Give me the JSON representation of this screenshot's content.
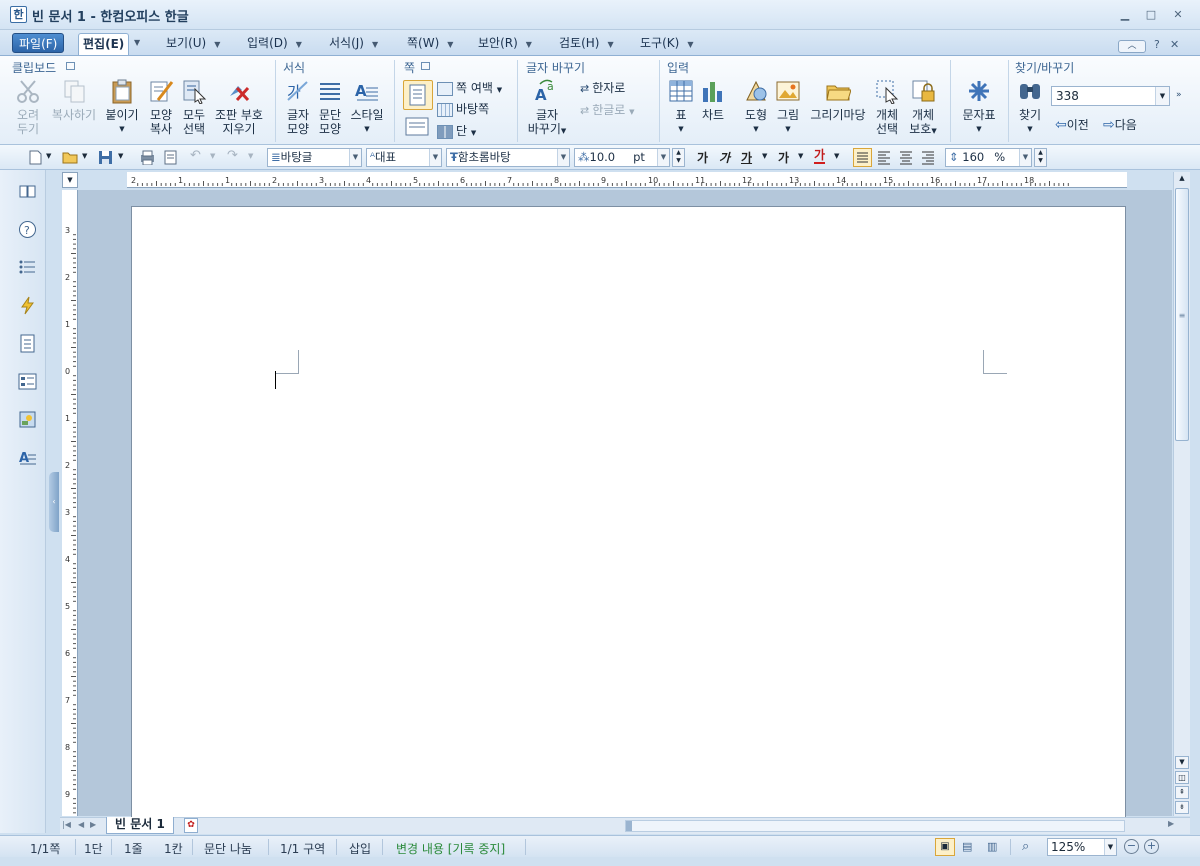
{
  "window": {
    "title": "빈 문서 1 - 한컴오피스 한글",
    "app_icon": "한"
  },
  "menus": [
    {
      "label": "파일(F)"
    },
    {
      "label": "편집(E)"
    },
    {
      "label": "보기(U)"
    },
    {
      "label": "입력(D)"
    },
    {
      "label": "서식(J)"
    },
    {
      "label": "쪽(W)"
    },
    {
      "label": "보안(R)"
    },
    {
      "label": "검토(H)"
    },
    {
      "label": "도구(K)"
    }
  ],
  "ribbon": {
    "groups": {
      "clipboard": "클립보드",
      "format": "서식",
      "page": "쪽",
      "convert": "글자 바꾸기",
      "insert": "입력",
      "find": "찾기/바꾸기"
    },
    "buttons": {
      "cut": "오려\n두기",
      "copy": "복사하기",
      "paste": "붙이기",
      "shape_copy": "모양\n복사",
      "select_all": "모두\n선택",
      "clear_marks": "조판 부호\n지우기",
      "char_shape": "글자\n모양",
      "para_shape": "문단\n모양",
      "style": "스타일",
      "page_margin": "쪽 여백",
      "background_page": "바탕쪽",
      "column": "단",
      "char_convert": "글자\n바꾸기",
      "to_hanja": "한자로",
      "to_hangul": "한글로",
      "table": "표",
      "chart": "차트",
      "shape": "도형",
      "picture": "그림",
      "drawing_gallery": "그리기마당",
      "select_object": "개체\n선택",
      "protect_object": "개체\n보호",
      "char_map": "문자표",
      "find": "찾기",
      "find_value": "338",
      "prev": "이전",
      "next": "다음"
    }
  },
  "toolbar": {
    "style": "바탕글",
    "lang": "대표",
    "font": "함초롬바탕",
    "size": "10.0",
    "size_unit": "pt",
    "bold": "가",
    "italic": "가",
    "underline": "가",
    "strike": "가",
    "color": "가",
    "line_spacing": "160",
    "line_spacing_unit": "%"
  },
  "ruler": {
    "h_ticks": [
      "2",
      "1",
      "1",
      "2",
      "3",
      "4",
      "5",
      "6",
      "7",
      "8",
      "9",
      "10",
      "11",
      "12",
      "13",
      "14",
      "15",
      "16",
      "17",
      "18"
    ],
    "v_ticks": [
      "3",
      "2",
      "1",
      "0",
      "1",
      "2",
      "3",
      "4",
      "5",
      "6",
      "7",
      "8",
      "9"
    ]
  },
  "doc_tab": {
    "label": "빈 문서 1"
  },
  "status": {
    "page": "1/1쪽",
    "column": "1단",
    "line": "1줄",
    "col": "1칸",
    "para_break": "문단 나눔",
    "section": "1/1 구역",
    "mode": "삽입",
    "track": "변경 내용 [기록 중지]",
    "zoom": "125%"
  },
  "colors": {
    "accent": "#2c64a8",
    "track_text": "#2a8a3a"
  }
}
